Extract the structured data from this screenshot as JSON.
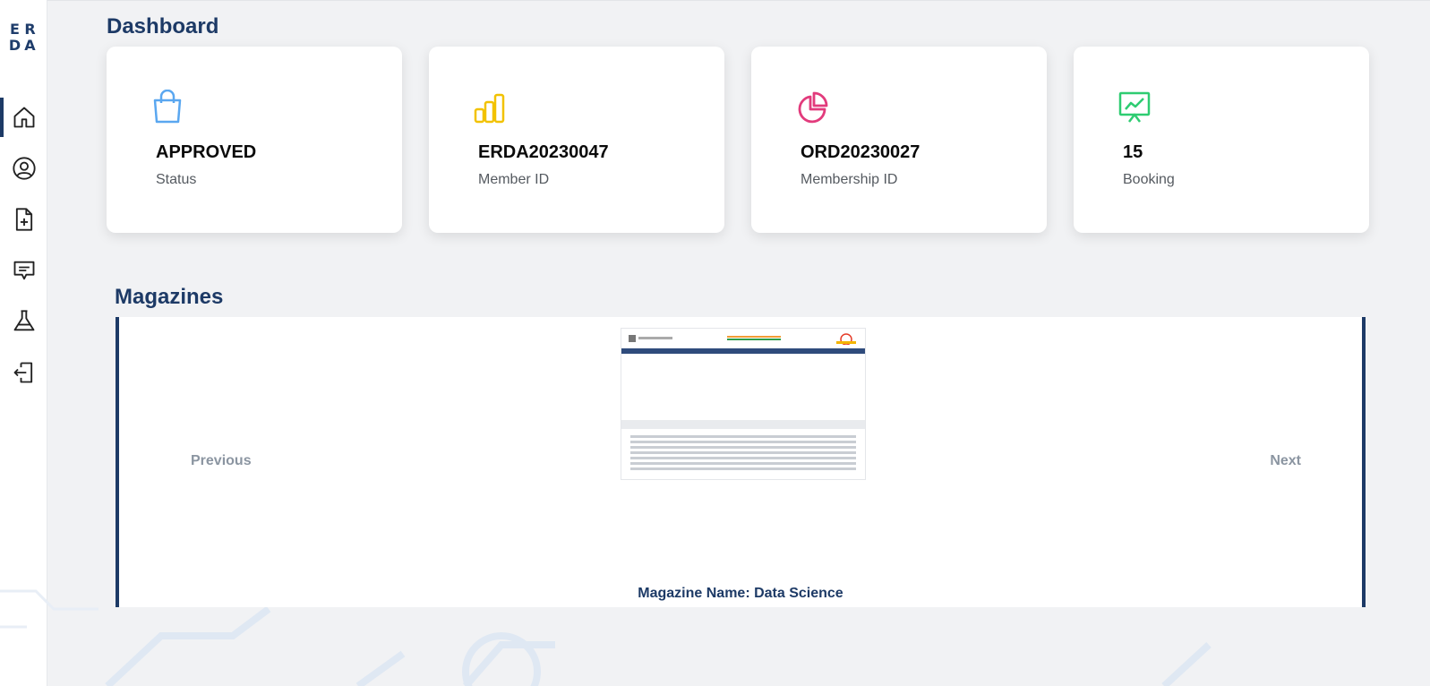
{
  "logo": {
    "letters": [
      "E",
      "R",
      "D",
      "A"
    ]
  },
  "sidebar": {
    "items": [
      {
        "icon": "home-icon",
        "active": true
      },
      {
        "icon": "user-circle-icon",
        "active": false
      },
      {
        "icon": "file-add-icon",
        "active": false
      },
      {
        "icon": "message-icon",
        "active": false
      },
      {
        "icon": "flask-icon",
        "active": false
      },
      {
        "icon": "logout-icon",
        "active": false
      }
    ]
  },
  "dashboard": {
    "title": "Dashboard",
    "cards": [
      {
        "value": "APPROVED",
        "label": "Status",
        "icon": "shopping-bag-icon",
        "color": "#5aa7f0"
      },
      {
        "value": "ERDA20230047",
        "label": "Member ID",
        "icon": "bar-chart-icon",
        "color": "#f2c200"
      },
      {
        "value": "ORD20230027",
        "label": "Membership ID",
        "icon": "pie-chart-icon",
        "color": "#e23b7c"
      },
      {
        "value": "15",
        "label": "Booking",
        "icon": "presentation-chart-icon",
        "color": "#2ecc71"
      }
    ]
  },
  "magazines": {
    "title": "Magazines",
    "previous_label": "Previous",
    "next_label": "Next",
    "magazine_name": "Magazine Name: Data Science"
  }
}
